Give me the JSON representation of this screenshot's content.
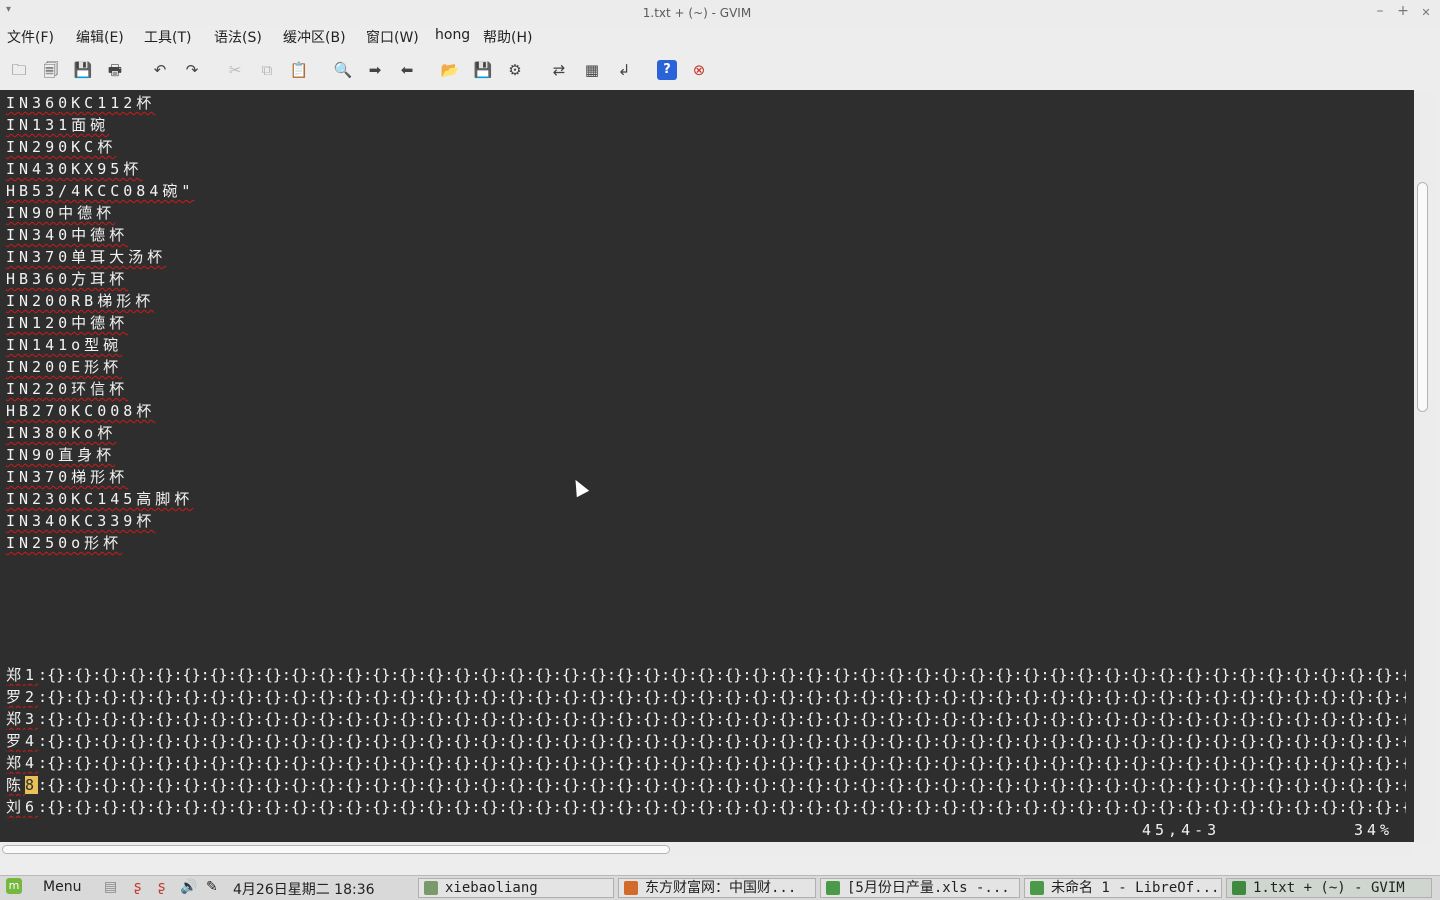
{
  "window": {
    "title": "1.txt + (~) - GVIM",
    "menu_glyph": "▾",
    "min_glyph": "–",
    "max_glyph": "+",
    "close_glyph": "✕"
  },
  "menu": [
    "文件(F)",
    "编辑(E)",
    "工具(T)",
    "语法(S)",
    "缓冲区(B)",
    "窗口(W)",
    "hong",
    "帮助(H)"
  ],
  "toolbar": {
    "icons": [
      "open-icon",
      "save-session-icon",
      "save-icon",
      "print-icon",
      "undo-icon",
      "redo-icon",
      "cut-icon",
      "copy-icon",
      "paste-icon",
      "find-icon",
      "find-next-icon",
      "find-prev-icon",
      "load-session-icon",
      "save-session-icon",
      "run-script-icon",
      "make-icon",
      "shell-icon",
      "ctags-icon",
      "help-icon",
      "find-help-icon"
    ],
    "glyphs": [
      "🗀",
      "🗐",
      "💾",
      "🖶",
      "↶",
      "↷",
      "✂",
      "⧉",
      "📋",
      "🔍",
      "➡",
      "⬅",
      "📂",
      "💾",
      "⚙",
      "⇄",
      "▦",
      "↲",
      "?",
      "⊗"
    ]
  },
  "editor": {
    "lines": [
      "IN360KC112杯",
      "IN131面碗",
      "IN290KC杯",
      "IN430KX95杯",
      "HB53/4KCC084碗\"",
      "IN90中德杯",
      "IN340中德杯",
      "IN370单耳大汤杯",
      "HB360方耳杯",
      "IN200RB梯形杯",
      "IN120中德杯",
      "IN141o型碗",
      "IN200E形杯",
      "IN220环信杯",
      "HB270KC008杯",
      "IN380Ko杯",
      "IN90直身杯",
      "IN370梯形杯",
      "IN230KC145高脚杯",
      "IN340KC339杯",
      "IN250o形杯"
    ],
    "grid_rows": [
      {
        "name": "郑",
        "num": "1"
      },
      {
        "name": "罗",
        "num": "2"
      },
      {
        "name": "郑",
        "num": "3"
      },
      {
        "name": "罗",
        "num": "4"
      },
      {
        "name": "郑",
        "num": "4"
      },
      {
        "name": "陈",
        "num": "8"
      },
      {
        "name": "刘",
        "num": "6"
      }
    ],
    "grid_pattern": ":{}:{}:{}:{}:{}:{}:{}:{}:{}:{}:{}:{}:{}:{}:{}:{}:{}:{}:{}:{}:{}:{}:{}:{}:{}:{}:{}:{}:{}:{}:{}:{}:{}:{}:{}:{}:{}:{}:{}:{}:{}:{}:{}:{}:{}:{}:{}:{}:{}:{}:{}:{}:{}:{}:{}:{}:{}:{}:{}:{}:{}:{}:{}:{}:{}:{}:{}:{}:{}:{}:{}:{}:{}:{}:{}:{}:{}:{}:{}:{}:{}:{}:{}:{}:{}:{}:{}:{}:{}:{}:{}:{}:{}:{}:{}:{}:{}:{}:{}:{}:{}:{}:{}:{}:{}:{}:{}:{}:{}:{}:{}:{}:{}:{}:{}:{}:{}:{}:{}:{}:{}:{}:{}:{}:{}:{}:{}:{}:{}:{}:{}:{}:{}:{}:{}:{}:{}:{}:{}:{}:{}:{}:{}:{}:{}:{}:{}:{}:{}:{}:{}:{}:{}:{}:{}:{}:{}:{}:{}:{}:{}:{}:{}:{}:{}:{}:{}:{}:{}:",
    "cursor_row": 5,
    "status_pos": "45,4-3",
    "status_pct": "34%"
  },
  "taskbar": {
    "menu_label": "Menu",
    "datetime": "4月26日星期二 18:36",
    "tasks": [
      {
        "label": "xiebaoliang",
        "color": "#7a9a6a"
      },
      {
        "label": "东方财富网：中国财...",
        "color": "#d26a2a"
      },
      {
        "label": "[5月份日产量.xls -...",
        "color": "#4a9a4a"
      },
      {
        "label": "未命名 1 - LibreOf...",
        "color": "#4a9a4a"
      },
      {
        "label": "1.txt + (~) - GVIM",
        "color": "#3f8a3f",
        "active": true
      }
    ]
  }
}
